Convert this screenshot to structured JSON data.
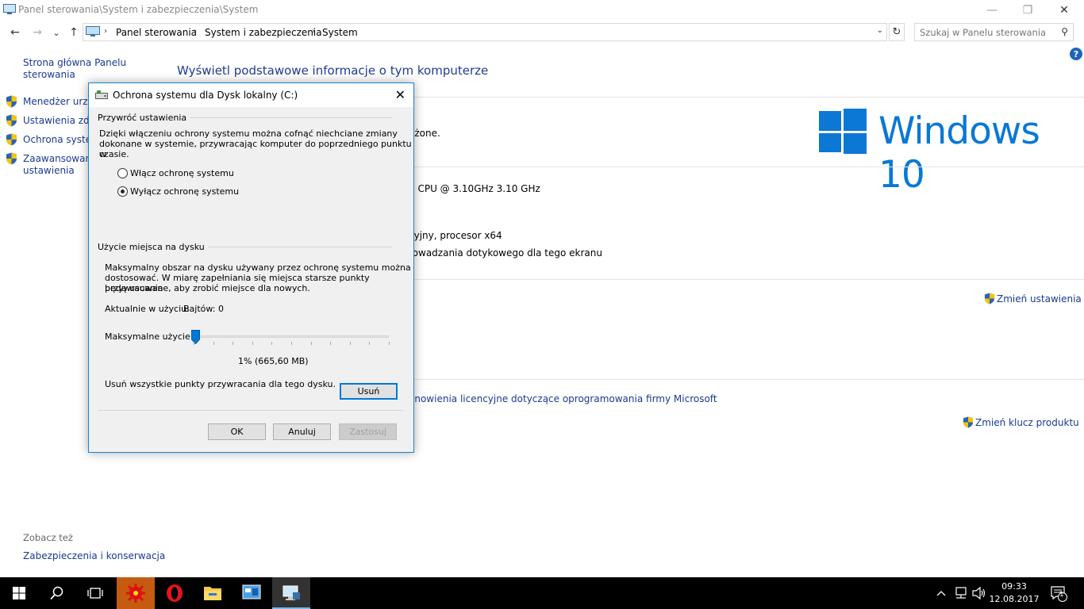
{
  "window": {
    "title": "Panel sterowania\\System i zabezpieczenia\\System",
    "minimize_glyph": "—",
    "restore_glyph": "❐",
    "close_glyph": "✕"
  },
  "nav": {
    "back_glyph": "←",
    "forward_glyph": "→",
    "recent_glyph": "⌄",
    "up_glyph": "↑",
    "breadcrumbs": [
      "Panel sterowania",
      "System i zabezpieczenia",
      "System"
    ],
    "separator_glyph": "›",
    "dropdown_glyph": "⌄",
    "refresh_glyph": "↻",
    "search_placeholder": "Szukaj w Panelu sterowania",
    "search_glyph": "⚲",
    "help_glyph": "?"
  },
  "leftnav": {
    "home": "Strona główna Panelu sterowania",
    "items": [
      {
        "label": "Menedżer urządzeń"
      },
      {
        "label": "Ustawienia zdalne"
      },
      {
        "label": "Ochrona systemu"
      },
      {
        "label": "Zaawansowane ustawienia systemu"
      }
    ],
    "see_also_title": "Zobacz też",
    "see_also_link": "Zabezpieczenia i konserwacja"
  },
  "main": {
    "title": "Wyświetl podstawowe informacje o tym komputerze",
    "copyright_tail": "eżone.",
    "cpu_tail": "0 CPU @ 3.10GHz   3.10 GHz",
    "systype_tail": "cyjny, procesor x64",
    "touch_tail": "rowadzania dotykowego dla tego ekranu",
    "change_settings": "Zmień ustawienia",
    "license_tail": "anowienia licencyjne dotyczące oprogramowania firmy Microsoft",
    "change_key": "Zmień klucz produktu",
    "windows_brand": "Windows 10"
  },
  "dialog": {
    "title": "Ochrona systemu dla Dysk lokalny (C:)",
    "close_glyph": "✕",
    "restore_group": "Przywróć ustawienia",
    "restore_desc_1": "Dzięki włączeniu ochrony systemu można cofnąć niechciane zmiany",
    "restore_desc_2": "dokonane w systemie, przywracając komputer do poprzedniego punktu w",
    "restore_desc_3": "czasie.",
    "radio_on": "Włącz ochronę systemu",
    "radio_off": "Wyłącz ochronę systemu",
    "selected_option": "off",
    "usage_group": "Użycie miejsca na dysku",
    "usage_desc_1": "Maksymalny obszar na dysku używany przez ochronę systemu można",
    "usage_desc_2": "dostosować. W miarę zapełniania się miejsca starsze punkty przywracania",
    "usage_desc_3": "będą usuwane, aby zrobić miejsce dla nowych.",
    "current_label": "Aktualnie w użyciu:",
    "current_value": "Bajtów: 0",
    "max_label": "Maksymalne użycie:",
    "max_percent": 1,
    "max_value": "1% (665,60 MB)",
    "delete_desc": "Usuń wszystkie punkty przywracania dla tego dysku.",
    "delete_button": "Usuń",
    "ok_button": "OK",
    "cancel_button": "Anuluj",
    "apply_button": "Zastosuj"
  },
  "taskbar": {
    "time": "09:33",
    "date": "12.08.2017",
    "notification_count": "1",
    "tray_up_glyph": "^",
    "volume_glyph": "🔊"
  },
  "colors": {
    "accent": "#0078d7",
    "link": "#1a3a8f",
    "windows_blue": "#0a78d4"
  }
}
